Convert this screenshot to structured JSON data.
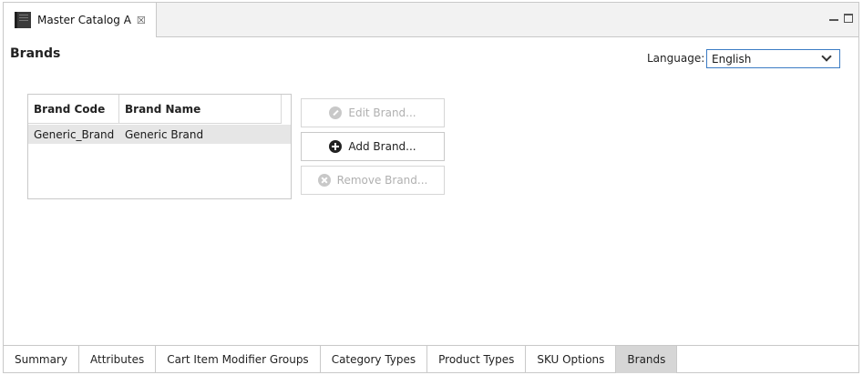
{
  "editor_tab": {
    "title": "Master Catalog A",
    "close_glyph": "☒"
  },
  "page": {
    "title": "Brands"
  },
  "language": {
    "label": "Language:",
    "selected": "English"
  },
  "table": {
    "headers": [
      "Brand Code",
      "Brand Name"
    ],
    "rows": [
      {
        "code": "Generic_Brand",
        "name": "Generic Brand"
      }
    ]
  },
  "buttons": {
    "edit": "Edit Brand...",
    "add": "Add Brand...",
    "remove": "Remove Brand..."
  },
  "bottom_tabs": [
    {
      "label": "Summary"
    },
    {
      "label": "Attributes"
    },
    {
      "label": "Cart Item Modifier Groups"
    },
    {
      "label": "Category Types"
    },
    {
      "label": "Product Types"
    },
    {
      "label": "SKU Options"
    },
    {
      "label": "Brands"
    }
  ],
  "active_bottom_tab": "Brands",
  "colors": {
    "accent_border": "#3b7cc4",
    "active_tab": "#d6d6d6",
    "selected_row": "#e6e6e6"
  },
  "icons": [
    "catalog-icon",
    "close-icon",
    "minimize-icon",
    "maximize-icon",
    "chevron-down-icon",
    "edit-icon",
    "add-icon",
    "remove-icon"
  ]
}
